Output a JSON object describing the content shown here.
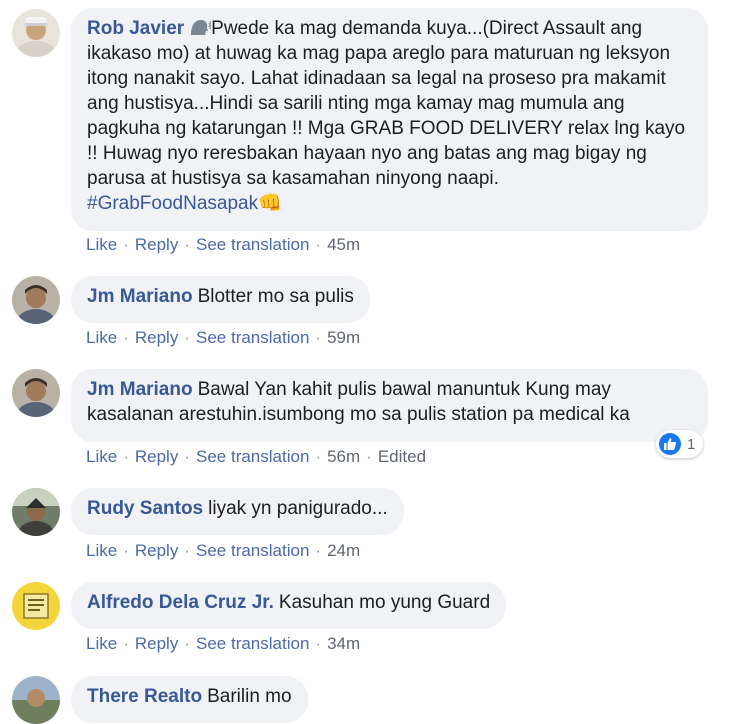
{
  "comments": [
    {
      "author": "Rob Javier",
      "text": "Pwede ka mag demanda kuya...(Direct Assault ang ikakaso mo) at huwag ka mag papa areglo para maturuan ng leksyon itong nanakit sayo. Lahat idinadaan sa legal na proseso pra makamit ang hustisya...Hindi sa sarili nting mga kamay mag mumula ang pagkuha ng katarungan !! Mga GRAB FOOD DELIVERY relax lng kayo !! Huwag nyo reresbakan hayaan nyo ang batas ang mag bigay ng parusa at hustisya sa kasamahan ninyong naapi.",
      "hashtag": "#GrabFoodNasapak",
      "emoji": "👊",
      "like": "Like",
      "reply": "Reply",
      "translate": "See translation",
      "time": "45m"
    },
    {
      "author": "Jm Mariano",
      "text": "Blotter mo sa pulis",
      "like": "Like",
      "reply": "Reply",
      "translate": "See translation",
      "time": "59m"
    },
    {
      "author": "Jm Mariano",
      "text": "Bawal Yan kahit pulis bawal manuntuk Kung may kasalanan arestuhin.isumbong mo sa pulis station pa medical ka",
      "like": "Like",
      "reply": "Reply",
      "translate": "See translation",
      "time": "56m",
      "edited": "Edited",
      "reaction_count": "1"
    },
    {
      "author": "Rudy Santos",
      "text": "liyak yn panigurado...",
      "like": "Like",
      "reply": "Reply",
      "translate": "See translation",
      "time": "24m"
    },
    {
      "author": "Alfredo Dela Cruz Jr.",
      "text": "Kasuhan mo yung Guard",
      "like": "Like",
      "reply": "Reply",
      "translate": "See translation",
      "time": "34m"
    },
    {
      "author": "There Realto",
      "text": "Barilin mo"
    }
  ],
  "colors": {
    "link": "#385898",
    "bubble": "#f0f2f5",
    "reaction": "#1877f2"
  },
  "icons": [
    "speaking-head-emoji-icon",
    "fist-emoji-icon",
    "like-reaction-icon"
  ]
}
